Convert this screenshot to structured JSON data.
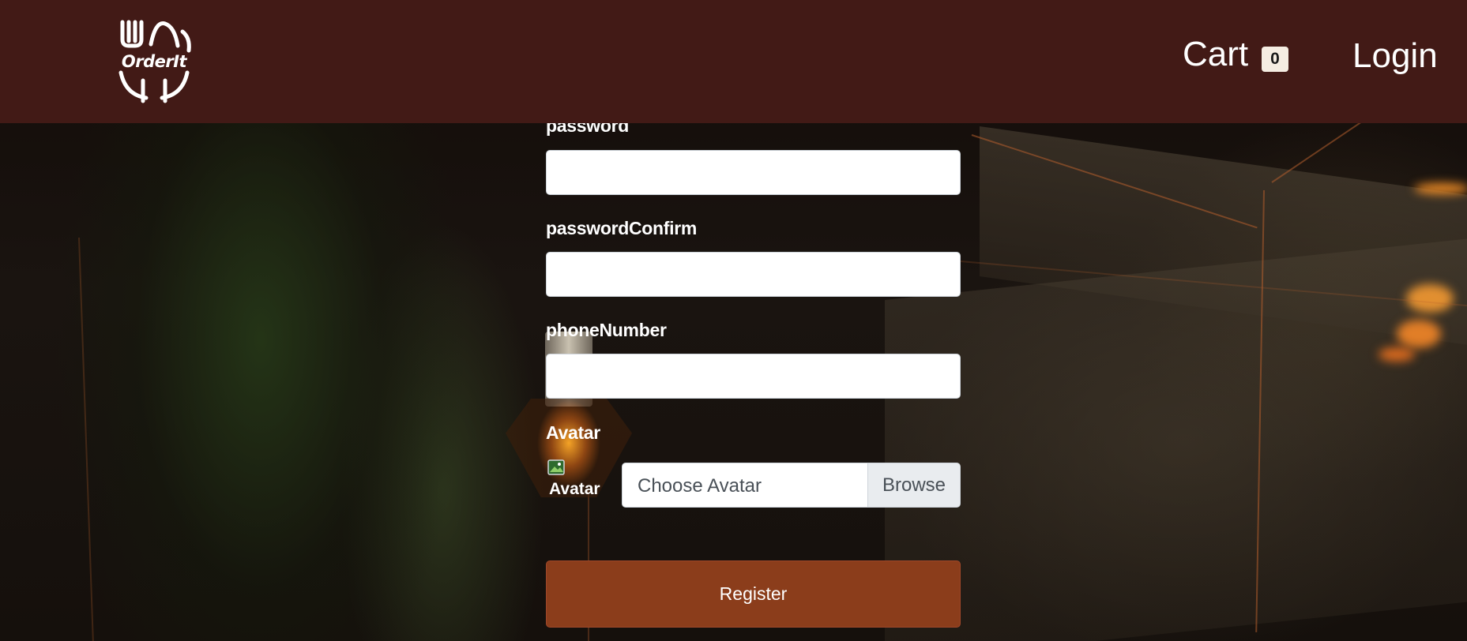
{
  "header": {
    "logo_text": "OrderIt",
    "cart_label": "Cart",
    "cart_count": "0",
    "login_label": "Login"
  },
  "form": {
    "password_label": "password",
    "password_value": "",
    "password_confirm_label": "passwordConfirm",
    "password_confirm_value": "",
    "phone_label": "phoneNumber",
    "phone_value": "",
    "avatar_label": "Avatar",
    "avatar_preview_alt": "Avatar",
    "avatar_placeholder": "Choose Avatar",
    "browse_label": "Browse",
    "register_label": "Register"
  },
  "colors": {
    "header_bg": "#421a16",
    "register_bg": "#8b3d1b",
    "badge_bg": "#f5ede2"
  }
}
